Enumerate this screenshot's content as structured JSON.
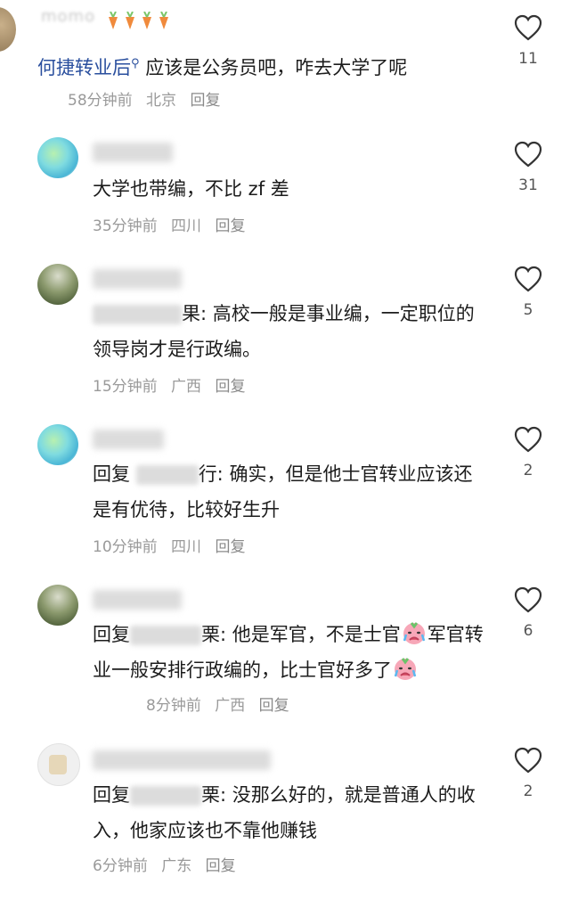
{
  "comments": [
    {
      "username": "momo",
      "text_link": "何捷转业后",
      "text": "应该是公务员吧，咋去大学了呢",
      "time": "58分钟前",
      "location": "北京",
      "reply_label": "回复",
      "likes": "11"
    },
    {
      "username": "",
      "text": "大学也带编，不比 zf 差",
      "time": "35分钟前",
      "location": "四川",
      "reply_label": "回复",
      "likes": "31"
    },
    {
      "username": "",
      "reply_to_suffix": "果:",
      "text": "高校一般是事业编，一定职位的领导岗才是行政编。",
      "time": "15分钟前",
      "location": "广西",
      "reply_label": "回复",
      "likes": "5"
    },
    {
      "username": "",
      "reply_prefix": "回复",
      "reply_to_suffix": "行:",
      "text": "确实，但是他士官转业应该还是有优待，比较好生升",
      "time": "10分钟前",
      "location": "四川",
      "reply_label": "回复",
      "likes": "2"
    },
    {
      "username": "",
      "reply_prefix": "回复",
      "reply_to_suffix": "栗:",
      "text_a": "他是军官，不是士官",
      "text_b": "军官转业一般安排行政编的，比士官好多了",
      "time": "8分钟前",
      "location": "广西",
      "reply_label": "回复",
      "likes": "6"
    },
    {
      "username": "",
      "reply_prefix": "回复",
      "reply_to_suffix": "栗:",
      "text": "没那么好的，就是普通人的收入，他家应该也不靠他赚钱",
      "time": "6分钟前",
      "location": "广东",
      "reply_label": "回复",
      "likes": "2"
    }
  ],
  "colors": {
    "link": "#2a4f9e",
    "meta": "#9a9a9a",
    "text": "#1c1c1c"
  }
}
